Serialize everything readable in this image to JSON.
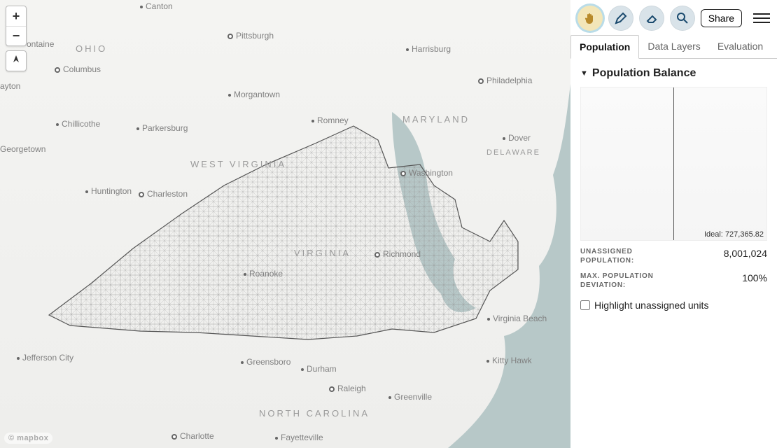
{
  "toolbar": {
    "share_label": "Share",
    "tools": [
      "pan",
      "draw",
      "erase",
      "inspect"
    ]
  },
  "tabs": {
    "population": "Population",
    "data_layers": "Data Layers",
    "evaluation": "Evaluation"
  },
  "panel": {
    "section_title": "Population Balance",
    "ideal_label": "Ideal:",
    "ideal_value": "727,365.82",
    "unassigned_label": "UNASSIGNED POPULATION:",
    "unassigned_value": "8,001,024",
    "deviation_label": "MAX. POPULATION DEVIATION:",
    "deviation_value": "100%",
    "highlight_label": "Highlight unassigned units",
    "highlight_checked": false
  },
  "map": {
    "attribution": "© mapbox",
    "states": {
      "ohio": "OHIO",
      "west_virginia": "WEST VIRGINIA",
      "virginia": "VIRGINIA",
      "maryland": "MARYLAND",
      "delaware": "DELAWARE",
      "north_carolina": "NORTH CAROLINA"
    },
    "cities": {
      "canton": "Canton",
      "pittsburgh": "Pittsburgh",
      "columbus": "Columbus",
      "ayton": "ayton",
      "chillicothe": "Chillicothe",
      "parkersburg": "Parkersburg",
      "morgantown": "Morgantown",
      "ontaine": "ontaine",
      "huntington": "Huntington",
      "charleston": "Charleston",
      "georgetown": "Georgetown",
      "roanoke": "Roanoke",
      "harrisburg": "Harrisburg",
      "philadelphia": "Philadelphia",
      "washington": "Washington",
      "dover": "Dover",
      "romney": "Romney",
      "richmond": "Richmond",
      "virginia_beach": "Virginia Beach",
      "kitty_hawk": "Kitty Hawk",
      "greensboro": "Greensboro",
      "durham": "Durham",
      "raleigh": "Raleigh",
      "greenville": "Greenville",
      "fayetteville": "Fayetteville",
      "charlotte": "Charlotte",
      "jefferson_city": "Jefferson City"
    }
  }
}
